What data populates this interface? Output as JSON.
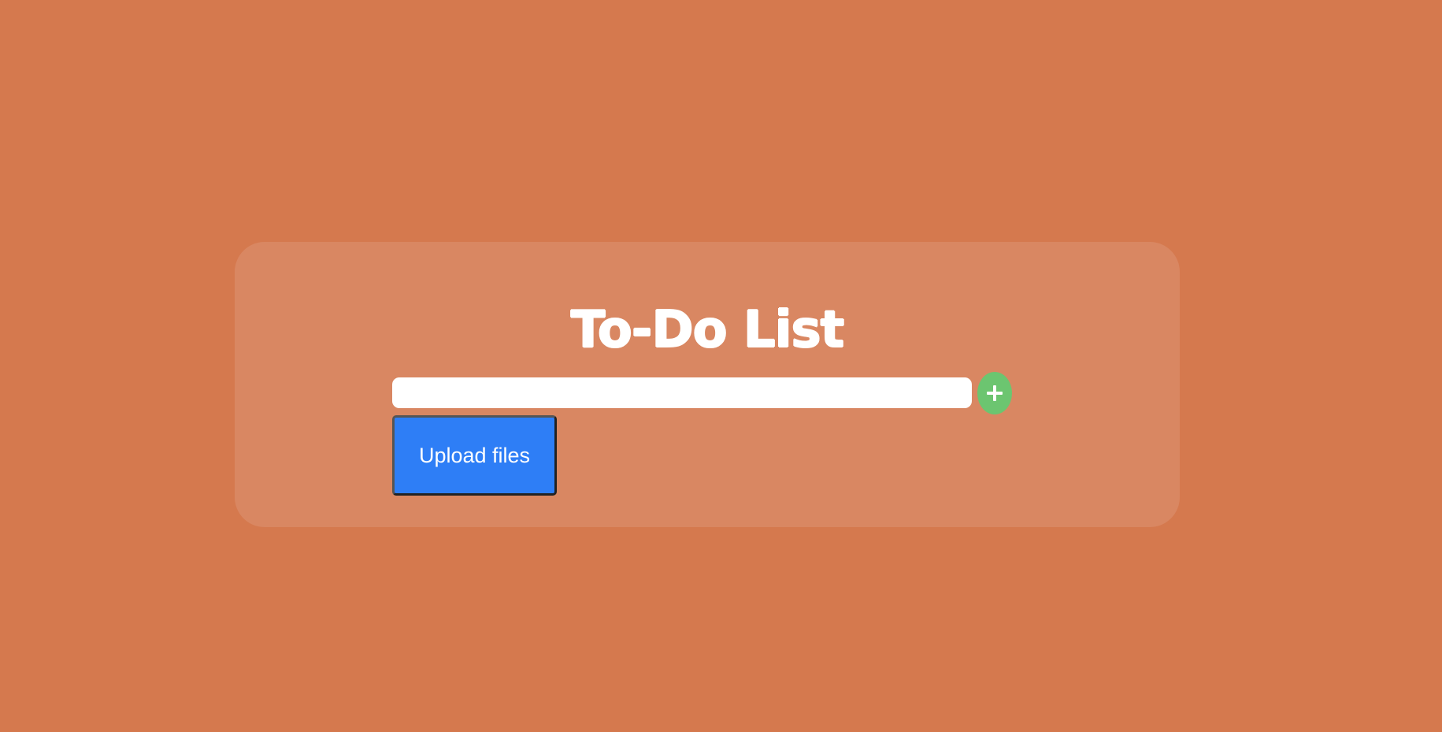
{
  "page": {
    "background_color": "#d5794e"
  },
  "card": {
    "background_color": "#d98762",
    "title": "To-Do List"
  },
  "task_entry": {
    "value": "",
    "placeholder": ""
  },
  "add_button": {
    "icon": "plus-icon",
    "color": "#6cc570"
  },
  "upload_button": {
    "label": "Upload files",
    "color": "#2e7ef6"
  }
}
